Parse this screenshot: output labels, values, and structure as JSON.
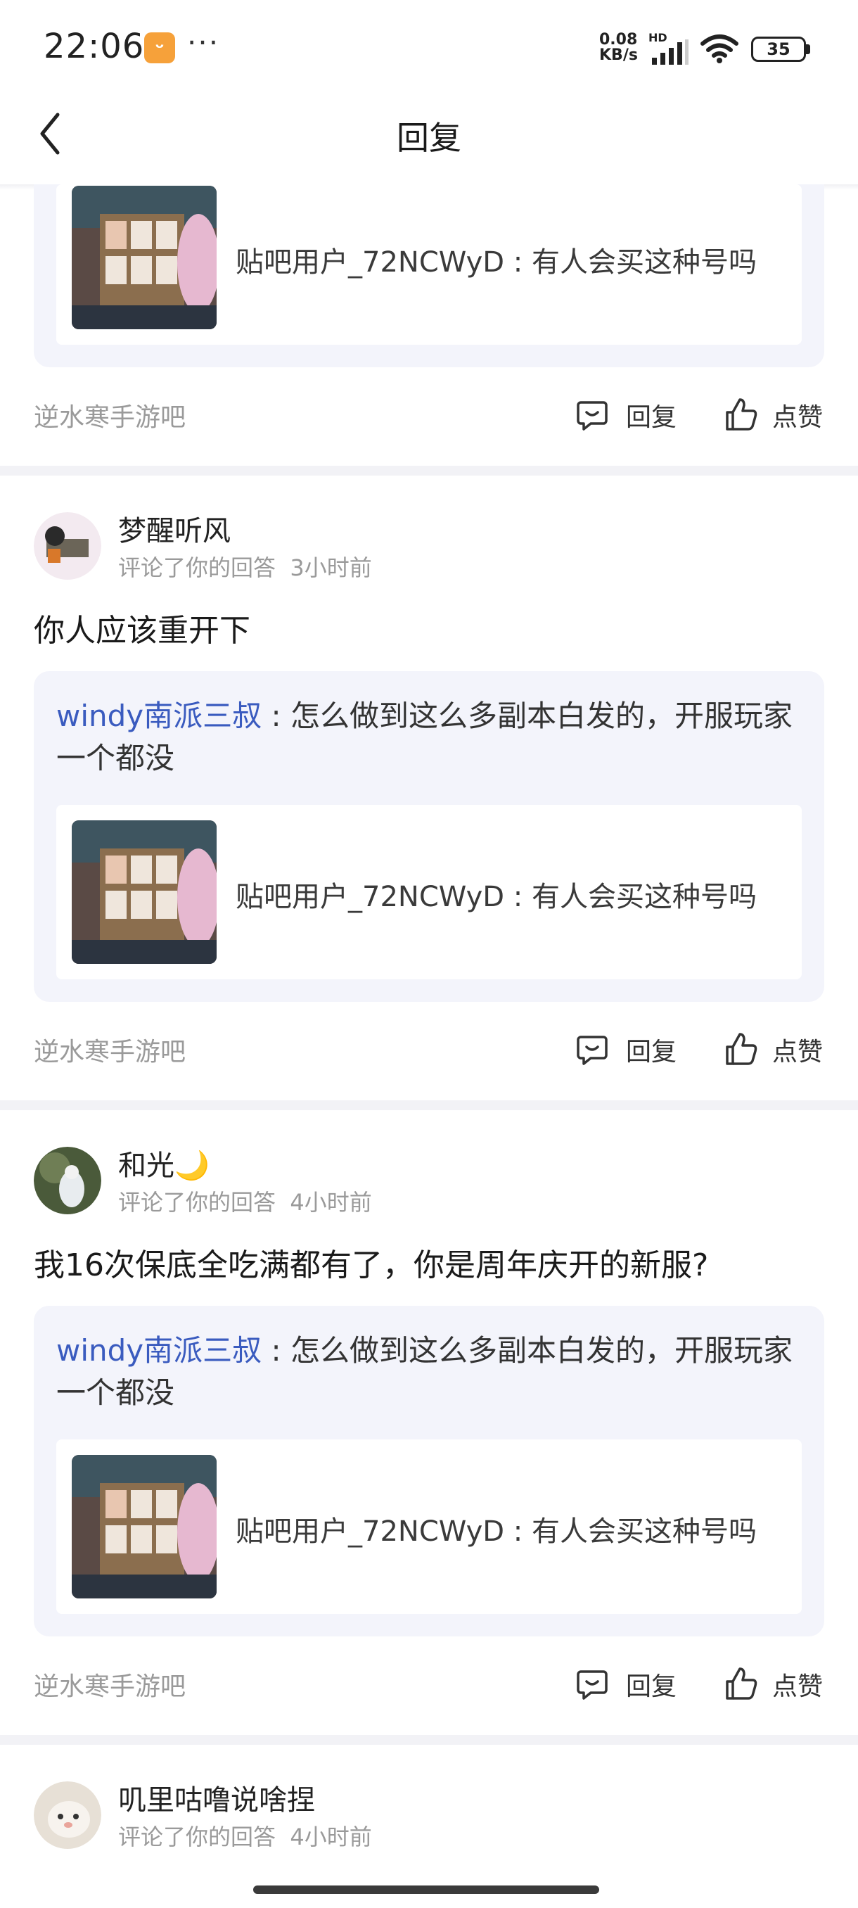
{
  "status_bar": {
    "time": "22:06",
    "app_badge_icon": "app-smile-icon",
    "more": "···",
    "net_speed_value": "0.08",
    "net_speed_unit": "KB/s",
    "network_type": "HD",
    "battery": "35"
  },
  "nav": {
    "title": "回复",
    "back_icon": "chevron-left-icon"
  },
  "items": [
    {
      "inner_text": "贴吧用户_72NCWyD : 有人会买这种号吗",
      "forum": "逆水寒手游吧",
      "reply_label": "回复",
      "like_label": "点赞"
    },
    {
      "username": "梦醒听风",
      "action": "评论了你的回答",
      "time": "3小时前",
      "content": "你人应该重开下",
      "quote_author": "windy南派三叔",
      "quote_text": " : 怎么做到这么多副本白发的，开服玩家一个都没",
      "inner_text": "贴吧用户_72NCWyD : 有人会买这种号吗",
      "forum": "逆水寒手游吧",
      "reply_label": "回复",
      "like_label": "点赞"
    },
    {
      "username": "和光🌙",
      "action": "评论了你的回答",
      "time": "4小时前",
      "content": "我16次保底全吃满都有了，你是周年庆开的新服?",
      "quote_author": "windy南派三叔",
      "quote_text": " : 怎么做到这么多副本白发的，开服玩家一个都没",
      "inner_text": "贴吧用户_72NCWyD : 有人会买这种号吗",
      "forum": "逆水寒手游吧",
      "reply_label": "回复",
      "like_label": "点赞"
    },
    {
      "username": "叽里咕噜说啥捏",
      "action": "评论了你的回答",
      "time": "4小时前"
    }
  ],
  "colors": {
    "quote_author": "#3a5bbf",
    "quote_bg": "#f3f4fb",
    "divider": "#f2f2f6",
    "muted_text": "#9a9a9a"
  }
}
